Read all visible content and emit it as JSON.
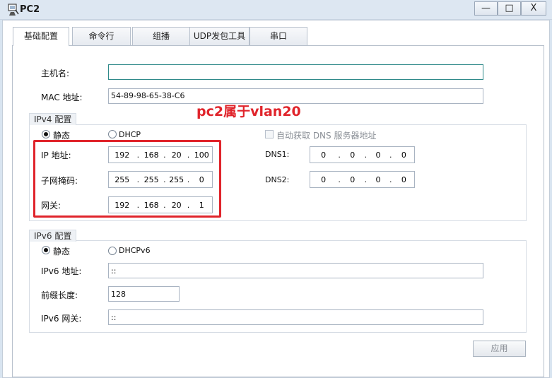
{
  "window": {
    "title": "PC2",
    "minimize_label": "—",
    "maximize_label": "□",
    "close_label": "X"
  },
  "tabs": [
    {
      "label": "基础配置"
    },
    {
      "label": "命令行"
    },
    {
      "label": "组播"
    },
    {
      "label": "UDP发包工具"
    },
    {
      "label": "串口"
    }
  ],
  "basic": {
    "hostname_label": "主机名:",
    "hostname_value": "",
    "mac_label": "MAC 地址:",
    "mac_value": "54-89-98-65-38-C6"
  },
  "ipv4": {
    "group_title": "IPv4 配置",
    "static_label": "静态",
    "dhcp_label": "DHCP",
    "auto_dns_label": "自动获取 DNS 服务器地址",
    "ip_label": "IP 地址:",
    "ip": [
      "192",
      "168",
      "20",
      "100"
    ],
    "mask_label": "子网掩码:",
    "mask": [
      "255",
      "255",
      "255",
      "0"
    ],
    "gateway_label": "网关:",
    "gateway": [
      "192",
      "168",
      "20",
      "1"
    ],
    "dns1_label": "DNS1:",
    "dns1": [
      "0",
      "0",
      "0",
      "0"
    ],
    "dns2_label": "DNS2:",
    "dns2": [
      "0",
      "0",
      "0",
      "0"
    ]
  },
  "ipv6": {
    "group_title": "IPv6 配置",
    "static_label": "静态",
    "dhcp_label": "DHCPv6",
    "addr_label": "IPv6 地址:",
    "addr_value": "::",
    "prefix_label": "前缀长度:",
    "prefix_value": "128",
    "gateway_label": "IPv6 网关:",
    "gateway_value": "::"
  },
  "annotation": {
    "text": "pc2属于vlan20",
    "color": "#e0242b"
  },
  "apply_label": "应用"
}
